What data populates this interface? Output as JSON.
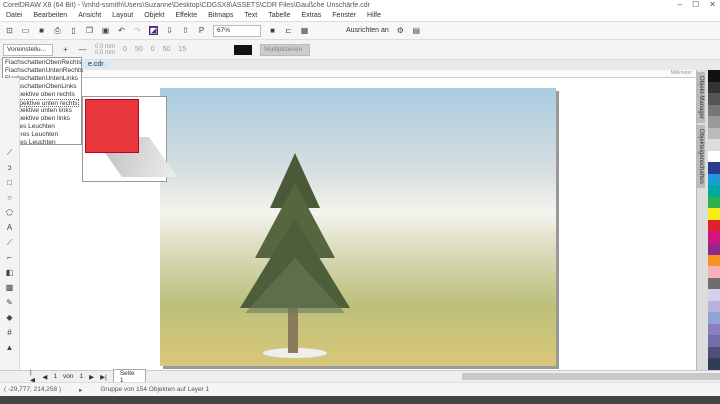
{
  "window": {
    "title": "CorelDRAW X8 (64 Bit) - \\\\mhd-ssmith\\Users\\Suzanne\\Desktop\\CDGSX8\\ASSETS\\CDR Files\\Gaußche Unschärfe.cdr"
  },
  "menu": [
    "Datei",
    "Bearbeiten",
    "Ansicht",
    "Layout",
    "Objekt",
    "Effekte",
    "Bitmaps",
    "Text",
    "Tabelle",
    "Extras",
    "Fenster",
    "Hilfe"
  ],
  "toolbar": {
    "zoom": "67%",
    "snap": "Ausrichten an"
  },
  "propbar": {
    "preset": "Voreinstellu...",
    "x": "0,0 mm",
    "y": "0,0 mm",
    "v1": "0",
    "v2": "50",
    "v3": "0",
    "v4": "50",
    "v5": "15",
    "mode": "Multiplizieren"
  },
  "doc_tab": "e.cdr",
  "ruler_unit": "Millimeter",
  "dropdown": {
    "items": [
      "FlachschattenObenRechts",
      "FlachschattenUntenRechts",
      "FlachschattenUntenLinks",
      "FlachschattenObenLinks",
      "Perspektive oben rechts",
      "Perspektive unten rechts",
      "Perspektive unten links",
      "Perspektive oben links",
      "Kleines Leuchten",
      "Mittleres Leuchten",
      "Starkes Leuchten"
    ],
    "highlighted": 5
  },
  "docker": {
    "tabs": [
      "Objekt-Manager",
      "Objekteigenschaften"
    ]
  },
  "palette": [
    "#111111",
    "#333333",
    "#555555",
    "#777777",
    "#999999",
    "#bbbbbb",
    "#dddddd",
    "#ffffff",
    "#2b3990",
    "#1c9bd7",
    "#00a99d",
    "#2bb24c",
    "#f7ec13",
    "#e02127",
    "#d4137f",
    "#92278f",
    "#f7941d",
    "#f9b0b6",
    "#6d6e71",
    "#d5d0ea",
    "#b7b2dd",
    "#8fa5d3",
    "#8a7fc0",
    "#706fa6",
    "#4f4e7a",
    "#2f3d56"
  ],
  "pagenav": {
    "current": "1",
    "of": "von",
    "total": "1",
    "page_tab": "Seite 1"
  },
  "status": {
    "coords": "( -29,777; 214,258 )",
    "message": "Gruppe von 154 Objekten auf Layer 1"
  }
}
